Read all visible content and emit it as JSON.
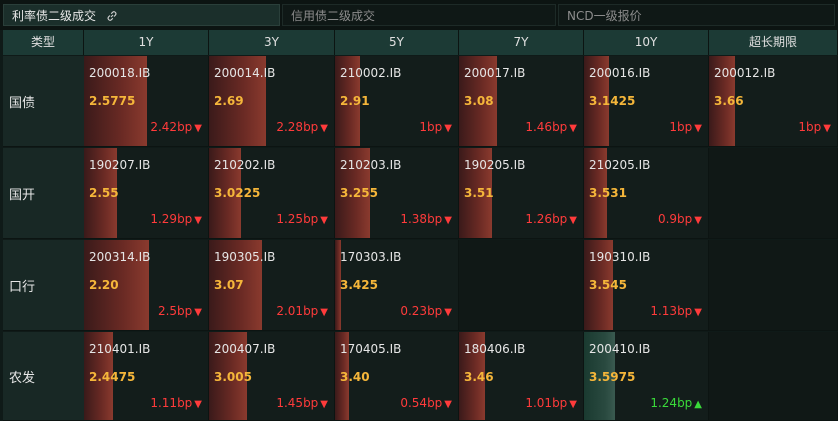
{
  "tabs": [
    {
      "label": "利率债二级成交",
      "active": true
    },
    {
      "label": "信用债二级成交",
      "active": false
    },
    {
      "label": "NCD一级报价",
      "active": false
    }
  ],
  "table": {
    "headers": [
      "类型",
      "1Y",
      "3Y",
      "5Y",
      "7Y",
      "10Y",
      "超长期限"
    ],
    "rows": [
      {
        "label": "国债",
        "cells": [
          {
            "code": "200018.IB",
            "rate": "2.5775",
            "change": "2.42bp",
            "dir": "down",
            "level": 0.5
          },
          {
            "code": "200014.IB",
            "rate": "2.69",
            "change": "2.28bp",
            "dir": "down",
            "level": 0.45
          },
          {
            "code": "210002.IB",
            "rate": "2.91",
            "change": "1bp",
            "dir": "down",
            "level": 0.2
          },
          {
            "code": "200017.IB",
            "rate": "3.08",
            "change": "1.46bp",
            "dir": "down",
            "level": 0.3
          },
          {
            "code": "200016.IB",
            "rate": "3.1425",
            "change": "1bp",
            "dir": "down",
            "level": 0.2
          },
          {
            "code": "200012.IB",
            "rate": "3.66",
            "change": "1bp",
            "dir": "down",
            "level": 0.2
          }
        ]
      },
      {
        "label": "国开",
        "cells": [
          {
            "code": "190207.IB",
            "rate": "2.55",
            "change": "1.29bp",
            "dir": "down",
            "level": 0.26
          },
          {
            "code": "210202.IB",
            "rate": "3.0225",
            "change": "1.25bp",
            "dir": "down",
            "level": 0.25
          },
          {
            "code": "210203.IB",
            "rate": "3.255",
            "change": "1.38bp",
            "dir": "down",
            "level": 0.28
          },
          {
            "code": "190205.IB",
            "rate": "3.51",
            "change": "1.26bp",
            "dir": "down",
            "level": 0.26
          },
          {
            "code": "210205.IB",
            "rate": "3.531",
            "change": "0.9bp",
            "dir": "down",
            "level": 0.18
          },
          null
        ]
      },
      {
        "label": "口行",
        "cells": [
          {
            "code": "200314.IB",
            "rate": "2.20",
            "change": "2.5bp",
            "dir": "down",
            "level": 0.52
          },
          {
            "code": "190305.IB",
            "rate": "3.07",
            "change": "2.01bp",
            "dir": "down",
            "level": 0.42
          },
          {
            "code": "170303.IB",
            "rate": "3.425",
            "change": "0.23bp",
            "dir": "down",
            "level": 0.05
          },
          null,
          {
            "code": "190310.IB",
            "rate": "3.545",
            "change": "1.13bp",
            "dir": "down",
            "level": 0.23
          },
          null
        ]
      },
      {
        "label": "农发",
        "cells": [
          {
            "code": "210401.IB",
            "rate": "2.4475",
            "change": "1.11bp",
            "dir": "down",
            "level": 0.23
          },
          {
            "code": "200407.IB",
            "rate": "3.005",
            "change": "1.45bp",
            "dir": "down",
            "level": 0.3
          },
          {
            "code": "170405.IB",
            "rate": "3.40",
            "change": "0.54bp",
            "dir": "down",
            "level": 0.11
          },
          {
            "code": "180406.IB",
            "rate": "3.46",
            "change": "1.01bp",
            "dir": "down",
            "level": 0.21
          },
          {
            "code": "200410.IB",
            "rate": "3.5975",
            "change": "1.24bp",
            "dir": "up",
            "level": 0.25
          },
          null
        ]
      }
    ]
  },
  "colors": {
    "rate_text": "#f5b63a",
    "down_change": "#ff3b3b",
    "up_change": "#3adb3a",
    "header_bg": "#1c3a35"
  },
  "icons": {
    "link": "link-icon",
    "down": "triangle-down-icon",
    "up": "triangle-up-icon"
  }
}
